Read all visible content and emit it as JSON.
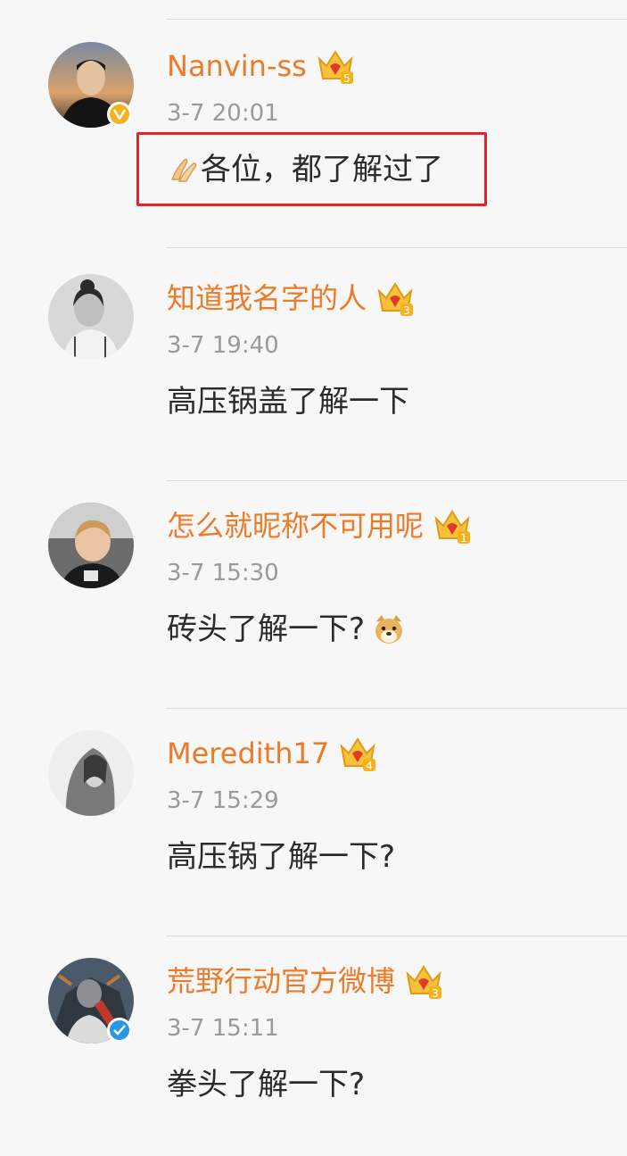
{
  "colors": {
    "background": "#f7f7f7",
    "username": "#ee7a27",
    "timestamp": "#9a9a9a",
    "text": "#2b2b2b",
    "highlight_border": "#e8202a",
    "verified_yellow": "#f5b21c",
    "verified_blue": "#2a96e6"
  },
  "comments": [
    {
      "username": "Nanvin-ss",
      "member_level": "5",
      "verified": "yellow",
      "timestamp": "3-7 20:01",
      "text": "各位，都了解过了",
      "emoji_prefix": "praying-hands-emoji",
      "highlighted": true
    },
    {
      "username": "知道我名字的人",
      "member_level": "3",
      "verified": "none",
      "timestamp": "3-7 19:40",
      "text": "高压锅盖了解一下",
      "highlighted": false
    },
    {
      "username": "怎么就昵称不可用呢",
      "member_level": "1",
      "verified": "none",
      "timestamp": "3-7 15:30",
      "text": "砖头了解一下?",
      "emoji_suffix": "doge-emoji",
      "highlighted": false
    },
    {
      "username": "Meredith17",
      "member_level": "4",
      "verified": "none",
      "timestamp": "3-7 15:29",
      "text": "高压锅了解一下?",
      "highlighted": false
    },
    {
      "username": "荒野行动官方微博",
      "member_level": "3",
      "verified": "blue",
      "timestamp": "3-7 15:11",
      "text": "拳头了解一下?",
      "highlighted": false
    }
  ]
}
